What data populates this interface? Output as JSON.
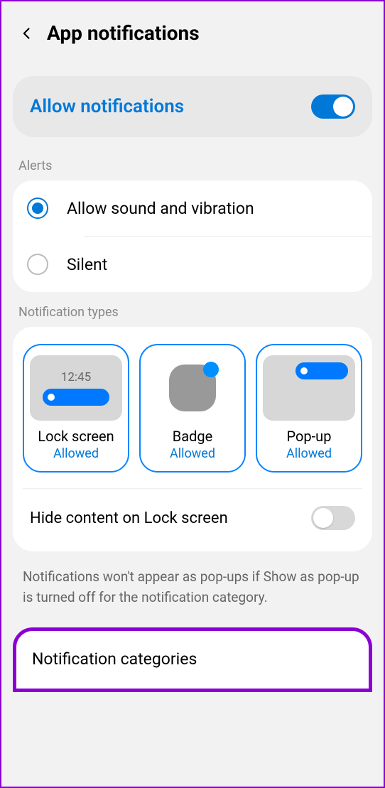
{
  "header": {
    "title": "App notifications"
  },
  "allow": {
    "label": "Allow notifications",
    "enabled": true
  },
  "alerts": {
    "section_label": "Alerts",
    "options": [
      {
        "label": "Allow sound and vibration",
        "selected": true
      },
      {
        "label": "Silent",
        "selected": false
      }
    ]
  },
  "types": {
    "section_label": "Notification types",
    "lock_screen_time": "12:45",
    "items": [
      {
        "title": "Lock screen",
        "status": "Allowed"
      },
      {
        "title": "Badge",
        "status": "Allowed"
      },
      {
        "title": "Pop-up",
        "status": "Allowed"
      }
    ]
  },
  "hide_content": {
    "label": "Hide content on Lock screen",
    "enabled": false
  },
  "hint": "Notifications won't appear as pop-ups if Show as pop-up is turned off for the notification category.",
  "categories": {
    "label": "Notification categories"
  }
}
